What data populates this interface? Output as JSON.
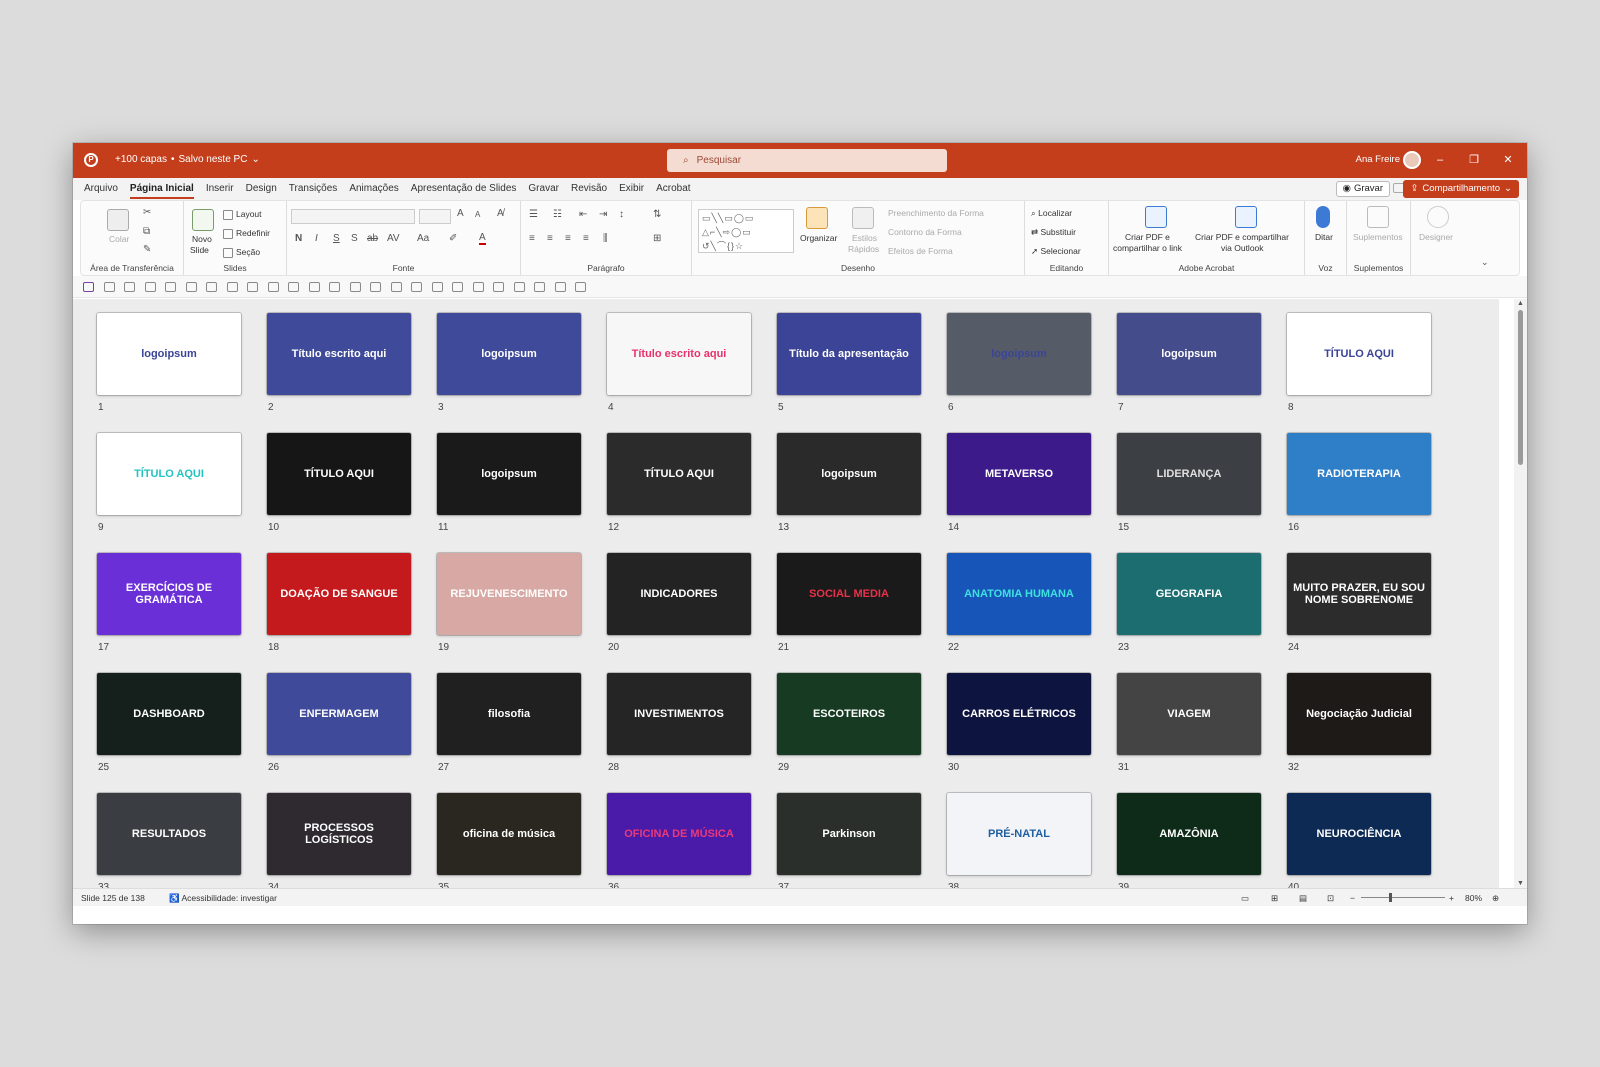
{
  "titlebar": {
    "app_icon": "powerpoint-logo-icon",
    "doc_title": "+100 capas",
    "save_state": "Salvo neste PC",
    "search_placeholder": "Pesquisar",
    "user_name": "Ana Freire",
    "window_controls": {
      "minimize": "–",
      "restore": "❐",
      "close": "✕"
    }
  },
  "menu": {
    "tabs": [
      "Arquivo",
      "Página Inicial",
      "Inserir",
      "Design",
      "Transições",
      "Animações",
      "Apresentação de Slides",
      "Gravar",
      "Revisão",
      "Exibir",
      "Acrobat"
    ],
    "active_tab": "Página Inicial",
    "record_label": "Gravar",
    "share_label": "Compartilhamento"
  },
  "ribbon": {
    "clipboard": {
      "paste": "Colar",
      "group": "Área de Transferência"
    },
    "slides": {
      "new_slide_1": "Novo",
      "new_slide_2": "Slide",
      "layout": "Layout",
      "reset": "Redefinir",
      "section": "Seção",
      "group": "Slides"
    },
    "font": {
      "group": "Fonte",
      "bold": "N",
      "italic": "I",
      "underline": "S",
      "shadow": "S",
      "strike": "ab",
      "spacing": "AV",
      "case": "Aa",
      "grow": "A",
      "shrink": "A",
      "color": "A"
    },
    "paragraph": {
      "group": "Parágrafo"
    },
    "drawing": {
      "arrange": "Organizar",
      "quick_styles_1": "Estilos",
      "quick_styles_2": "Rápidos",
      "fill": "Preenchimento da Forma",
      "outline": "Contorno da Forma",
      "effects": "Efeitos de Forma",
      "group": "Desenho"
    },
    "editing": {
      "find": "Localizar",
      "replace": "Substituir",
      "select": "Selecionar",
      "group": "Editando"
    },
    "acrobat": {
      "pdf_link_1": "Criar PDF e",
      "pdf_link_2": "compartilhar o link",
      "pdf_outlook_1": "Criar PDF e compartilhar",
      "pdf_outlook_2": "via Outlook",
      "group": "Adobe Acrobat"
    },
    "voice": {
      "dictate": "Ditar",
      "group": "Voz"
    },
    "addins": {
      "addins": "Suplementos",
      "group": "Suplementos"
    },
    "designer": {
      "designer": "Designer"
    }
  },
  "slides": [
    {
      "n": "1",
      "text": "logoipsum",
      "bg": "#ffffff",
      "fg": "#3b4496"
    },
    {
      "n": "2",
      "text": "Título escrito aqui",
      "bg": "#3f4b9a",
      "fg": "#ffffff"
    },
    {
      "n": "3",
      "text": "logoipsum",
      "bg": "#3f4b9a",
      "fg": "#ffffff"
    },
    {
      "n": "4",
      "text": "Título escrito aqui",
      "bg": "#f7f7f7",
      "fg": "#e8326c"
    },
    {
      "n": "5",
      "text": "Título da apresentação",
      "bg": "#3b4496",
      "fg": "#ffffff"
    },
    {
      "n": "6",
      "text": "logoipsum",
      "bg": "#555c68",
      "fg": "#3b4496"
    },
    {
      "n": "7",
      "text": "logoipsum",
      "bg": "#444c8c",
      "fg": "#ffffff"
    },
    {
      "n": "8",
      "text": "TÍTULO AQUI",
      "bg": "#ffffff",
      "fg": "#3b4496"
    },
    {
      "n": "9",
      "text": "TÍTULO AQUI",
      "bg": "#ffffff",
      "fg": "#25c2c2"
    },
    {
      "n": "10",
      "text": "TÍTULO AQUI",
      "bg": "#161616",
      "fg": "#ffffff"
    },
    {
      "n": "11",
      "text": "logoipsum",
      "bg": "#1a1a1a",
      "fg": "#ffffff"
    },
    {
      "n": "12",
      "text": "TÍTULO AQUI",
      "bg": "#2b2b2b",
      "fg": "#ffffff"
    },
    {
      "n": "13",
      "text": "logoipsum",
      "bg": "#2a2a2a",
      "fg": "#ffffff"
    },
    {
      "n": "14",
      "text": "METAVERSO",
      "bg": "#3d1a8a",
      "fg": "#ffffff"
    },
    {
      "n": "15",
      "text": "LIDERANÇA",
      "bg": "#3c3f44",
      "fg": "#e0e0e0"
    },
    {
      "n": "16",
      "text": "RADIOTERAPIA",
      "bg": "#2f7fc8",
      "fg": "#ffffff"
    },
    {
      "n": "17",
      "text": "EXERCÍCIOS DE GRAMÁTICA",
      "bg": "#6a2fd6",
      "fg": "#ffffff"
    },
    {
      "n": "18",
      "text": "DOAÇÃO DE SANGUE",
      "bg": "#c41a1e",
      "fg": "#ffffff"
    },
    {
      "n": "19",
      "text": "REJUVENESCIMENTO",
      "bg": "#d8a9a4",
      "fg": "#ffffff"
    },
    {
      "n": "20",
      "text": "INDICADORES",
      "bg": "#232323",
      "fg": "#ffffff"
    },
    {
      "n": "21",
      "text": "SOCIAL MEDIA",
      "bg": "#1a1a1a",
      "fg": "#e8324a"
    },
    {
      "n": "22",
      "text": "ANATOMIA HUMANA",
      "bg": "#1756b8",
      "fg": "#3fe0e0"
    },
    {
      "n": "23",
      "text": "GEOGRAFIA",
      "bg": "#1c6d70",
      "fg": "#ffffff"
    },
    {
      "n": "24",
      "text": "MUITO PRAZER, EU SOU NOME SOBRENOME",
      "bg": "#2c2c2c",
      "fg": "#ffffff"
    },
    {
      "n": "25",
      "text": "DASHBOARD",
      "bg": "#15201c",
      "fg": "#ffffff"
    },
    {
      "n": "26",
      "text": "ENFERMAGEM",
      "bg": "#3f4b9a",
      "fg": "#ffffff"
    },
    {
      "n": "27",
      "text": "filosofia",
      "bg": "#202020",
      "fg": "#ffffff"
    },
    {
      "n": "28",
      "text": "INVESTIMENTOS",
      "bg": "#252525",
      "fg": "#ffffff"
    },
    {
      "n": "29",
      "text": "ESCOTEIROS",
      "bg": "#163b22",
      "fg": "#ffffff"
    },
    {
      "n": "30",
      "text": "CARROS ELÉTRICOS",
      "bg": "#0e1440",
      "fg": "#ffffff"
    },
    {
      "n": "31",
      "text": "VIAGEM",
      "bg": "#444444",
      "fg": "#ffffff"
    },
    {
      "n": "32",
      "text": "Negociação Judicial",
      "bg": "#1e1a18",
      "fg": "#ffffff"
    },
    {
      "n": "33",
      "text": "RESULTADOS",
      "bg": "#3a3d42",
      "fg": "#ffffff"
    },
    {
      "n": "34",
      "text": "PROCESSOS LOGÍSTICOS",
      "bg": "#2e2a30",
      "fg": "#ffffff"
    },
    {
      "n": "35",
      "text": "oficina de música",
      "bg": "#2a2720",
      "fg": "#ffffff"
    },
    {
      "n": "36",
      "text": "OFICINA DE MÚSICA",
      "bg": "#4a1aa8",
      "fg": "#e83a7a"
    },
    {
      "n": "37",
      "text": "Parkinson",
      "bg": "#2a2f2c",
      "fg": "#ffffff"
    },
    {
      "n": "38",
      "text": "PRÉ-NATAL",
      "bg": "#f2f4f8",
      "fg": "#1f5fa0"
    },
    {
      "n": "39",
      "text": "AMAZÔNIA",
      "bg": "#0e2a18",
      "fg": "#ffffff"
    },
    {
      "n": "40",
      "text": "NEUROCIÊNCIA",
      "bg": "#0d2a55",
      "fg": "#ffffff"
    }
  ],
  "status": {
    "slide_info": "Slide 125 de 138",
    "accessibility": "Acessibilidade: investigar",
    "zoom": "80%"
  }
}
